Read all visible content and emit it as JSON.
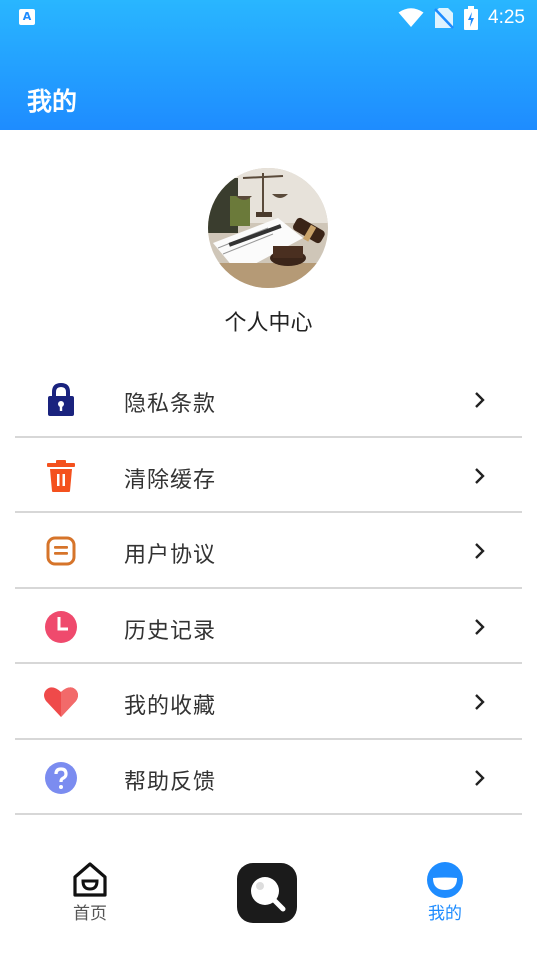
{
  "status_bar": {
    "app_icon_letter": "A",
    "time": "4:25"
  },
  "header": {
    "title": "我的"
  },
  "profile": {
    "name": "个人中心"
  },
  "menu": {
    "items": [
      {
        "label": "隐私条款",
        "icon": "lock-icon",
        "color": "#1a237e"
      },
      {
        "label": "清除缓存",
        "icon": "trash-icon",
        "color": "#f4511e"
      },
      {
        "label": "用户协议",
        "icon": "document-icon",
        "color": "#d6742a"
      },
      {
        "label": "历史记录",
        "icon": "clock-icon",
        "color": "#ef4a6d"
      },
      {
        "label": "我的收藏",
        "icon": "heart-icon",
        "color": "#ef4a4a"
      },
      {
        "label": "帮助反馈",
        "icon": "help-icon",
        "color": "#7b8cf0"
      }
    ]
  },
  "tabbar": {
    "home_label": "首页",
    "mine_label": "我的",
    "active_color": "#1e8cff"
  }
}
